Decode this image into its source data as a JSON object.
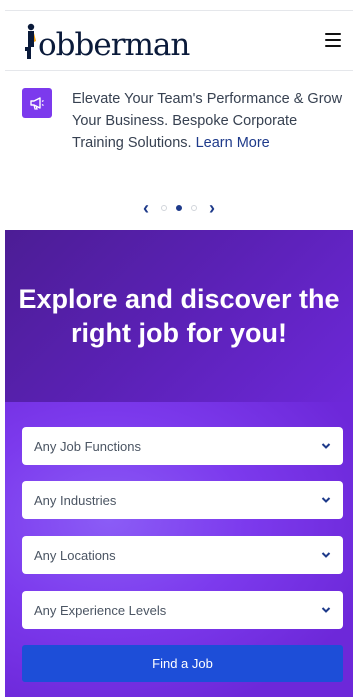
{
  "header": {
    "logo_text": "obberman",
    "menu_icon": "hamburger-icon"
  },
  "announcement": {
    "icon": "megaphone-icon",
    "text": "Elevate Your Team's Performance & Grow Your Business. Bespoke Corporate Training Solutions.",
    "link_text": "Learn More"
  },
  "carousel": {
    "prev_icon": "chevron-left-icon",
    "next_icon": "chevron-right-icon",
    "dots": 3,
    "active_dot": 2
  },
  "hero": {
    "title": "Explore and discover the right job for you!",
    "filters": [
      {
        "label": "Any Job Functions"
      },
      {
        "label": "Any Industries"
      },
      {
        "label": "Any Locations"
      },
      {
        "label": "Any Experience Levels"
      }
    ],
    "button_label": "Find a Job"
  },
  "colors": {
    "brand_navy": "#0a1a3a",
    "accent_purple": "#7c3aed",
    "link_blue": "#1e3a8a",
    "button_blue": "#1d4ed8"
  }
}
